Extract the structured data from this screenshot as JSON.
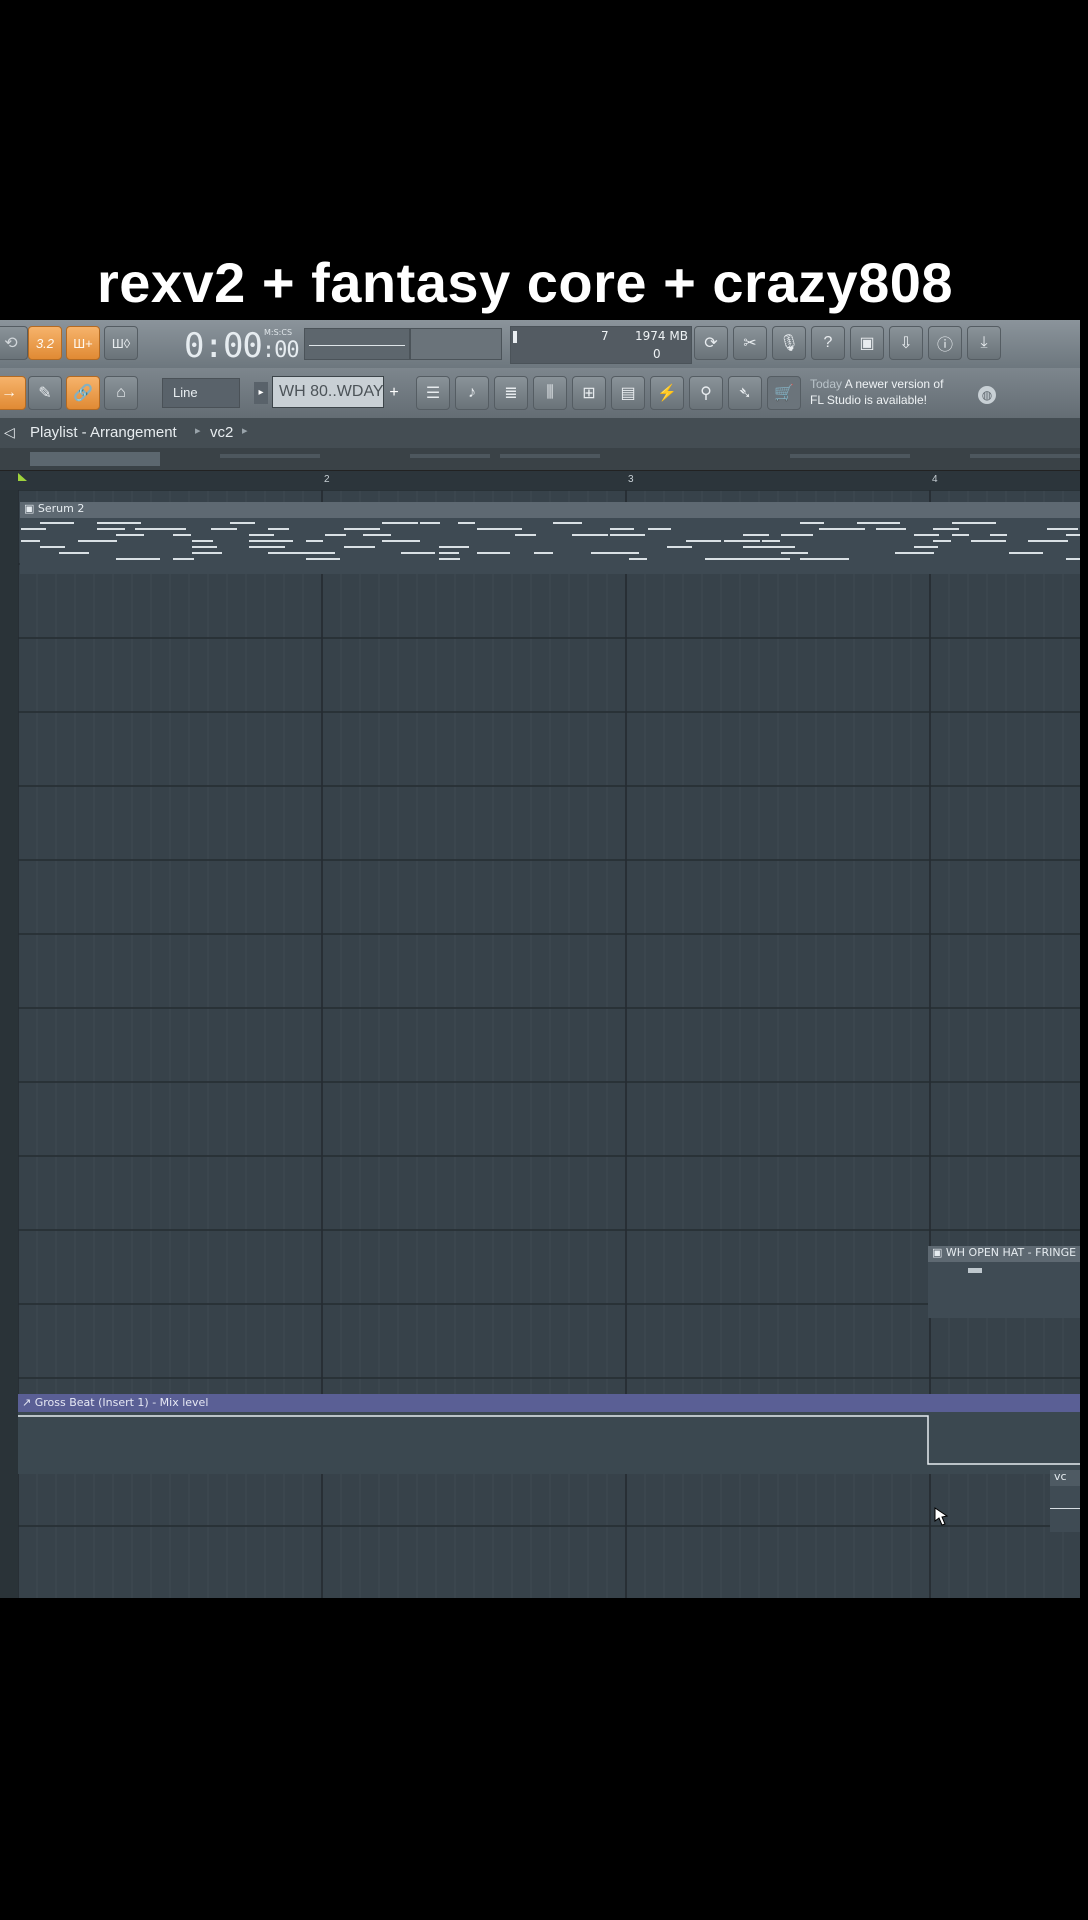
{
  "caption": "rexv2 + fantasy core + crazy808",
  "toolbar": {
    "time": "0:00",
    "time_small": "00",
    "time_unit": "M:S:CS",
    "cpu_value": "7",
    "memory": "1974 MB",
    "poly": "0",
    "snap_mode": "Line",
    "pattern": "WH 80..WDAY",
    "news_label": "Today",
    "news_line1": "A newer version of",
    "news_line2": "FL Studio is available!",
    "tempo_btn": "3.2",
    "btn_a": "Ш+",
    "btn_b": "Ш◊"
  },
  "breadcrumb": {
    "root": "Playlist - Arrangement",
    "current": "vc2"
  },
  "ruler": {
    "marks": [
      "2",
      "3",
      "4"
    ]
  },
  "tracks": {
    "serum": "Serum 2",
    "open_hat": "WH OPEN HAT -  FRINGE",
    "automation": "Gross Beat (Insert 1) - Mix level",
    "vc": "vc"
  }
}
